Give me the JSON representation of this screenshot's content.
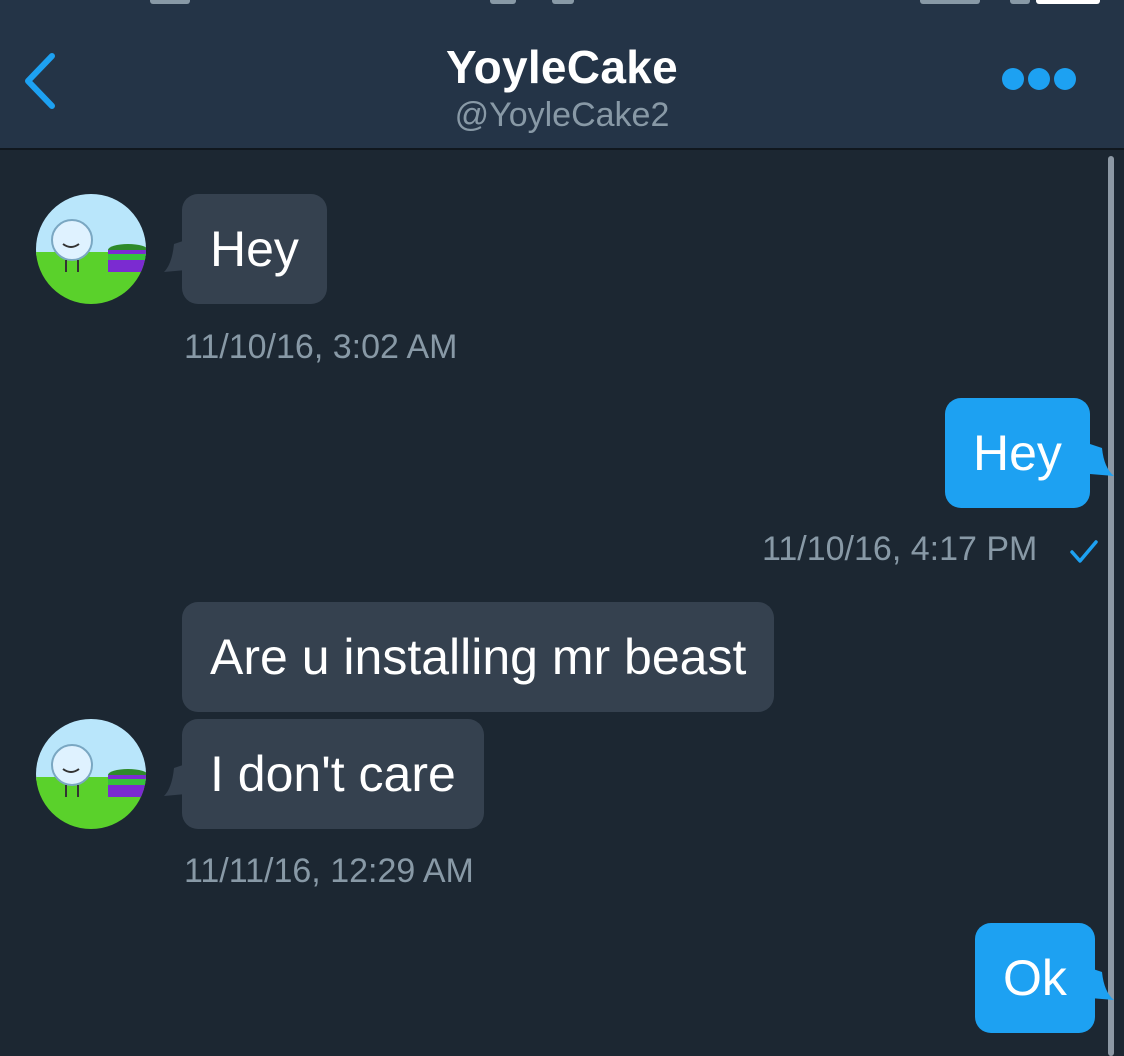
{
  "header": {
    "title": "YoyleCake",
    "handle": "@YoyleCake2",
    "back_icon": "chevron-left-icon",
    "more_icon": "more-horizontal-icon"
  },
  "colors": {
    "background": "#1c2732",
    "header": "#243447",
    "incoming_bubble": "#35414f",
    "outgoing_bubble": "#1da1f2",
    "timestamp": "#8899a6",
    "accent": "#1da1f2"
  },
  "messages": [
    {
      "direction": "incoming",
      "text": "Hey"
    },
    {
      "direction": "outgoing",
      "text": "Hey"
    },
    {
      "direction": "incoming",
      "text": "Are u installing mr beast"
    },
    {
      "direction": "incoming",
      "text": "I don't care"
    },
    {
      "direction": "outgoing",
      "text": "Ok"
    }
  ],
  "timestamps": [
    "11/10/16, 3:02 AM",
    "11/10/16, 4:17 PM",
    "11/11/16, 12:29 AM"
  ],
  "read_receipt_icon": "checkmark-icon"
}
